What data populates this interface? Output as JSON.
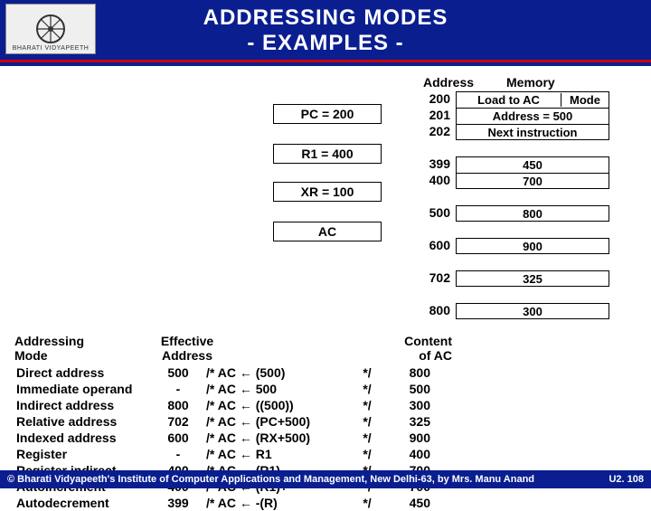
{
  "title_line1": "ADDRESSING  MODES",
  "title_line2": "- EXAMPLES -",
  "logo_text": "BHARATI   VIDYAPEETH",
  "headers": {
    "address": "Address",
    "memory": "Memory"
  },
  "registers": {
    "pc": "PC = 200",
    "r1": "R1 = 400",
    "xr": "XR = 100",
    "ac": "AC"
  },
  "memory": [
    {
      "addr": "200",
      "opcode": "Load to AC",
      "mode": "Mode"
    },
    {
      "addr": "201",
      "cell": "Address = 500"
    },
    {
      "addr": "202",
      "cell": "Next instruction"
    },
    {
      "gap": true
    },
    {
      "addr": "399",
      "cell": "450"
    },
    {
      "addr": "400",
      "cell": "700"
    },
    {
      "gap": true
    },
    {
      "addr": "500",
      "cell": "800"
    },
    {
      "gap": true
    },
    {
      "addr": "600",
      "cell": "900"
    },
    {
      "gap": true
    },
    {
      "addr": "702",
      "cell": "325"
    },
    {
      "gap": true
    },
    {
      "addr": "800",
      "cell": "300"
    }
  ],
  "modes_header": {
    "c1a": "Addressing",
    "c1b": "Mode",
    "c2a": "Effective",
    "c2b": "Address",
    "c4a": "Content",
    "c4b": "of AC"
  },
  "modes": [
    {
      "name": "Direct address",
      "ea": "500",
      "rule": "/* AC ← (500)",
      "cac": "800"
    },
    {
      "name": "Immediate operand",
      "ea": "-",
      "rule": "/* AC ← 500",
      "cac": "500"
    },
    {
      "name": "Indirect address",
      "ea": "800",
      "rule": "/* AC ← ((500))",
      "cac": "300"
    },
    {
      "name": "Relative address",
      "ea": "702",
      "rule": "/* AC ← (PC+500)",
      "cac": "325"
    },
    {
      "name": "Indexed address",
      "ea": "600",
      "rule": "/* AC ← (RX+500)",
      "cac": "900"
    },
    {
      "name": "Register",
      "ea": "-",
      "rule": "/* AC ← R1",
      "cac": "400"
    },
    {
      "name": "Register indirect",
      "ea": "400",
      "rule": "/* AC ← (R1)",
      "cac": "700"
    },
    {
      "name": "Autoincrement",
      "ea": "400",
      "rule": "/* AC ← (R1)+",
      "cac": "700"
    },
    {
      "name": "Autodecrement",
      "ea": "399",
      "rule": "/* AC ← -(R)",
      "cac": "450"
    }
  ],
  "star": "*/",
  "footer": {
    "left": "© Bharati Vidyapeeth's Institute of Computer Applications and Management, New Delhi-63, by Mrs. Manu Anand",
    "right": "U2. 108"
  }
}
